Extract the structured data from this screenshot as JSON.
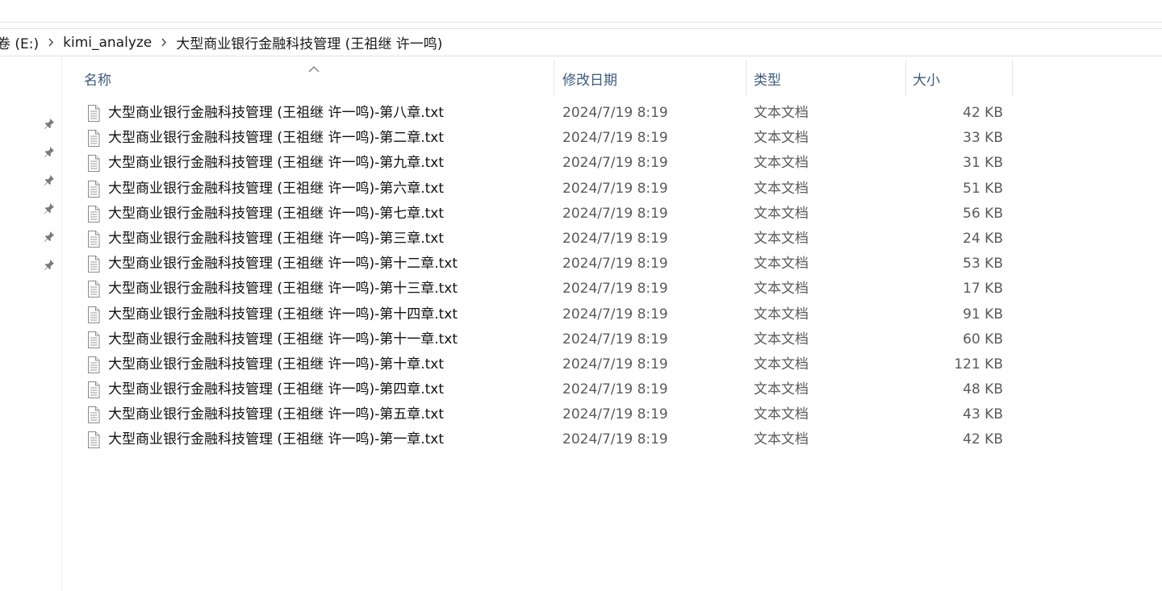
{
  "breadcrumb": {
    "drive": "卷 (E:)",
    "folder1": "kimi_analyze",
    "folder2": "大型商业银行金融科技管理 (王祖继  许一鸣)"
  },
  "columns": {
    "name": "名称",
    "date": "修改日期",
    "type": "类型",
    "size": "大小"
  },
  "icons": {
    "pin": "pin-icon",
    "file": "text-file-icon",
    "chevron": "chevron-right-icon",
    "sort": "sort-up-icon"
  },
  "colors": {
    "header_text": "#3c5a80",
    "secondary_text": "#5a5a5a"
  },
  "files": [
    {
      "name": "大型商业银行金融科技管理 (王祖继  许一鸣)-第八章.txt",
      "date": "2024/7/19 8:19",
      "type": "文本文档",
      "size": "42 KB"
    },
    {
      "name": "大型商业银行金融科技管理 (王祖继  许一鸣)-第二章.txt",
      "date": "2024/7/19 8:19",
      "type": "文本文档",
      "size": "33 KB"
    },
    {
      "name": "大型商业银行金融科技管理 (王祖继  许一鸣)-第九章.txt",
      "date": "2024/7/19 8:19",
      "type": "文本文档",
      "size": "31 KB"
    },
    {
      "name": "大型商业银行金融科技管理 (王祖继  许一鸣)-第六章.txt",
      "date": "2024/7/19 8:19",
      "type": "文本文档",
      "size": "51 KB"
    },
    {
      "name": "大型商业银行金融科技管理 (王祖继  许一鸣)-第七章.txt",
      "date": "2024/7/19 8:19",
      "type": "文本文档",
      "size": "56 KB"
    },
    {
      "name": "大型商业银行金融科技管理 (王祖继  许一鸣)-第三章.txt",
      "date": "2024/7/19 8:19",
      "type": "文本文档",
      "size": "24 KB"
    },
    {
      "name": "大型商业银行金融科技管理 (王祖继  许一鸣)-第十二章.txt",
      "date": "2024/7/19 8:19",
      "type": "文本文档",
      "size": "53 KB"
    },
    {
      "name": "大型商业银行金融科技管理 (王祖继  许一鸣)-第十三章.txt",
      "date": "2024/7/19 8:19",
      "type": "文本文档",
      "size": "17 KB"
    },
    {
      "name": "大型商业银行金融科技管理 (王祖继  许一鸣)-第十四章.txt",
      "date": "2024/7/19 8:19",
      "type": "文本文档",
      "size": "91 KB"
    },
    {
      "name": "大型商业银行金融科技管理 (王祖继  许一鸣)-第十一章.txt",
      "date": "2024/7/19 8:19",
      "type": "文本文档",
      "size": "60 KB"
    },
    {
      "name": "大型商业银行金融科技管理 (王祖继  许一鸣)-第十章.txt",
      "date": "2024/7/19 8:19",
      "type": "文本文档",
      "size": "121 KB"
    },
    {
      "name": "大型商业银行金融科技管理 (王祖继  许一鸣)-第四章.txt",
      "date": "2024/7/19 8:19",
      "type": "文本文档",
      "size": "48 KB"
    },
    {
      "name": "大型商业银行金融科技管理 (王祖继  许一鸣)-第五章.txt",
      "date": "2024/7/19 8:19",
      "type": "文本文档",
      "size": "43 KB"
    },
    {
      "name": "大型商业银行金融科技管理 (王祖继  许一鸣)-第一章.txt",
      "date": "2024/7/19 8:19",
      "type": "文本文档",
      "size": "42 KB"
    }
  ]
}
